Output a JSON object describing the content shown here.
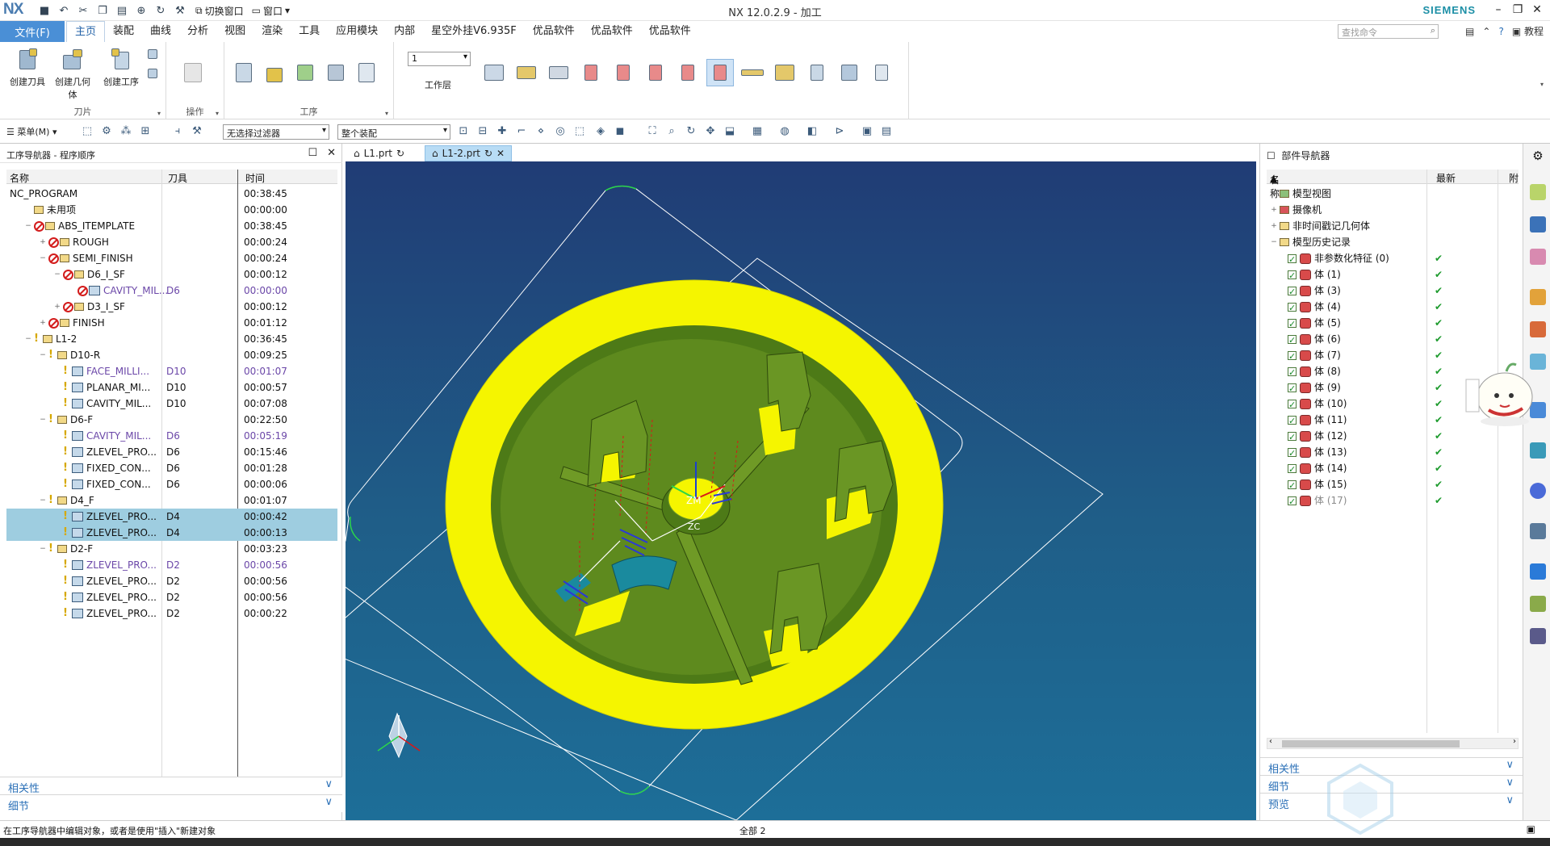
{
  "app": {
    "logo": "NX",
    "title": "NX 12.0.2.9 - 加工",
    "brand": "SIEMENS",
    "switch_window": "切换窗口",
    "window_menu": "窗口"
  },
  "menubar": {
    "file_label": "文件(F)",
    "tabs": [
      "主页",
      "装配",
      "曲线",
      "分析",
      "视图",
      "渲染",
      "工具",
      "应用模块",
      "内部",
      "星空外挂V6.935F",
      "优品软件",
      "优品软件",
      "优品软件"
    ],
    "active_tab": "主页",
    "search_placeholder": "查找命令",
    "help_label": "教程"
  },
  "ribbon": {
    "groups": [
      {
        "label": "刀片",
        "buttons": [
          "创建刀具",
          "创建几何体",
          "创建工序"
        ]
      },
      {
        "label": "操作"
      },
      {
        "label": "工序"
      }
    ],
    "work_layer_value": "1",
    "work_layer_label": "工作层"
  },
  "toolbar2": {
    "menu_label": "菜单(M)",
    "filter_combo": "无选择过滤器",
    "assembly_combo": "整个装配"
  },
  "op_navigator": {
    "title": "工序导航器 - 程序顺序",
    "columns": [
      "名称",
      "刀具",
      "时间"
    ],
    "rows": [
      {
        "indent": 0,
        "exp": "",
        "icon": "none",
        "name": "NC_PROGRAM",
        "tool": "",
        "time": "00:38:45",
        "muted": false,
        "sel": false
      },
      {
        "indent": 1,
        "exp": "",
        "icon": "fold",
        "name": "未用项",
        "tool": "",
        "time": "00:00:00",
        "muted": false,
        "sel": false
      },
      {
        "indent": 1,
        "exp": "−",
        "icon": "no-fold",
        "name": "ABS_ITEMPLATE",
        "tool": "",
        "time": "00:38:45",
        "muted": false,
        "sel": false
      },
      {
        "indent": 2,
        "exp": "+",
        "icon": "no-fold",
        "name": "ROUGH",
        "tool": "",
        "time": "00:00:24",
        "muted": false,
        "sel": false
      },
      {
        "indent": 2,
        "exp": "−",
        "icon": "no-fold",
        "name": "SEMI_FINISH",
        "tool": "",
        "time": "00:00:24",
        "muted": false,
        "sel": false
      },
      {
        "indent": 3,
        "exp": "−",
        "icon": "no-fold",
        "name": "D6_I_SF",
        "tool": "",
        "time": "00:00:12",
        "muted": false,
        "sel": false
      },
      {
        "indent": 4,
        "exp": "",
        "icon": "no-op",
        "name": "CAVITY_MIL...",
        "tool": "D6",
        "time": "00:00:00",
        "muted": true,
        "sel": false
      },
      {
        "indent": 3,
        "exp": "+",
        "icon": "no-fold",
        "name": "D3_I_SF",
        "tool": "",
        "time": "00:00:12",
        "muted": false,
        "sel": false
      },
      {
        "indent": 2,
        "exp": "+",
        "icon": "no-fold",
        "name": "FINISH",
        "tool": "",
        "time": "00:01:12",
        "muted": false,
        "sel": false
      },
      {
        "indent": 1,
        "exp": "−",
        "icon": "ok-fold",
        "name": "L1-2",
        "tool": "",
        "time": "00:36:45",
        "muted": false,
        "sel": false
      },
      {
        "indent": 2,
        "exp": "−",
        "icon": "ok-fold",
        "name": "D10-R",
        "tool": "",
        "time": "00:09:25",
        "muted": false,
        "sel": false
      },
      {
        "indent": 3,
        "exp": "",
        "icon": "ok-op",
        "name": "FACE_MILLI...",
        "tool": "D10",
        "time": "00:01:07",
        "muted": true,
        "sel": false
      },
      {
        "indent": 3,
        "exp": "",
        "icon": "ok-op",
        "name": "PLANAR_MI...",
        "tool": "D10",
        "time": "00:00:57",
        "muted": false,
        "sel": false
      },
      {
        "indent": 3,
        "exp": "",
        "icon": "ok-op",
        "name": "CAVITY_MIL...",
        "tool": "D10",
        "time": "00:07:08",
        "muted": false,
        "sel": false
      },
      {
        "indent": 2,
        "exp": "−",
        "icon": "ok-fold",
        "name": "D6-F",
        "tool": "",
        "time": "00:22:50",
        "muted": false,
        "sel": false
      },
      {
        "indent": 3,
        "exp": "",
        "icon": "ok-op",
        "name": "CAVITY_MIL...",
        "tool": "D6",
        "time": "00:05:19",
        "muted": true,
        "sel": false
      },
      {
        "indent": 3,
        "exp": "",
        "icon": "ok-op",
        "name": "ZLEVEL_PRO...",
        "tool": "D6",
        "time": "00:15:46",
        "muted": false,
        "sel": false
      },
      {
        "indent": 3,
        "exp": "",
        "icon": "ok-op",
        "name": "FIXED_CON...",
        "tool": "D6",
        "time": "00:01:28",
        "muted": false,
        "sel": false
      },
      {
        "indent": 3,
        "exp": "",
        "icon": "ok-op",
        "name": "FIXED_CON...",
        "tool": "D6",
        "time": "00:00:06",
        "muted": false,
        "sel": false
      },
      {
        "indent": 2,
        "exp": "−",
        "icon": "ok-fold",
        "name": "D4_F",
        "tool": "",
        "time": "00:01:07",
        "muted": false,
        "sel": false
      },
      {
        "indent": 3,
        "exp": "",
        "icon": "ok-op",
        "name": "ZLEVEL_PRO...",
        "tool": "D4",
        "time": "00:00:42",
        "muted": false,
        "sel": true
      },
      {
        "indent": 3,
        "exp": "",
        "icon": "ok-op",
        "name": "ZLEVEL_PRO...",
        "tool": "D4",
        "time": "00:00:13",
        "muted": false,
        "sel": true
      },
      {
        "indent": 2,
        "exp": "−",
        "icon": "ok-fold",
        "name": "D2-F",
        "tool": "",
        "time": "00:03:23",
        "muted": false,
        "sel": false
      },
      {
        "indent": 3,
        "exp": "",
        "icon": "ok-op",
        "name": "ZLEVEL_PRO...",
        "tool": "D2",
        "time": "00:00:56",
        "muted": true,
        "sel": false
      },
      {
        "indent": 3,
        "exp": "",
        "icon": "ok-op",
        "name": "ZLEVEL_PRO...",
        "tool": "D2",
        "time": "00:00:56",
        "muted": false,
        "sel": false
      },
      {
        "indent": 3,
        "exp": "",
        "icon": "ok-op",
        "name": "ZLEVEL_PRO...",
        "tool": "D2",
        "time": "00:00:56",
        "muted": false,
        "sel": false
      },
      {
        "indent": 3,
        "exp": "",
        "icon": "ok-op",
        "name": "ZLEVEL_PRO...",
        "tool": "D2",
        "time": "00:00:22",
        "muted": false,
        "sel": false
      }
    ],
    "sections": [
      "相关性",
      "细节"
    ]
  },
  "doc_tabs": [
    {
      "label": "L1.prt",
      "active": false
    },
    {
      "label": "L1-2.prt",
      "active": true
    }
  ],
  "viewport": {
    "labels": [
      "ZM",
      "ZC"
    ]
  },
  "part_navigator": {
    "title": "部件导航器",
    "columns": [
      "名称",
      "最新",
      "附"
    ],
    "rows": [
      {
        "indent": 0,
        "exp": "+",
        "kind": "view",
        "name": "模型视图",
        "latest": ""
      },
      {
        "indent": 0,
        "exp": "+",
        "kind": "camera",
        "name": "摄像机",
        "latest": ""
      },
      {
        "indent": 0,
        "exp": "+",
        "kind": "folder",
        "name": "非时间戳记几何体",
        "latest": ""
      },
      {
        "indent": 0,
        "exp": "−",
        "kind": "folder",
        "name": "模型历史记录",
        "latest": ""
      },
      {
        "indent": 1,
        "exp": "",
        "kind": "body",
        "name": "非参数化特征 (0)",
        "latest": "✔"
      },
      {
        "indent": 1,
        "exp": "",
        "kind": "body",
        "name": "体 (1)",
        "latest": "✔"
      },
      {
        "indent": 1,
        "exp": "",
        "kind": "body",
        "name": "体 (3)",
        "latest": "✔"
      },
      {
        "indent": 1,
        "exp": "",
        "kind": "body",
        "name": "体 (4)",
        "latest": "✔"
      },
      {
        "indent": 1,
        "exp": "",
        "kind": "body",
        "name": "体 (5)",
        "latest": "✔"
      },
      {
        "indent": 1,
        "exp": "",
        "kind": "body",
        "name": "体 (6)",
        "latest": "✔"
      },
      {
        "indent": 1,
        "exp": "",
        "kind": "body",
        "name": "体 (7)",
        "latest": "✔"
      },
      {
        "indent": 1,
        "exp": "",
        "kind": "body",
        "name": "体 (8)",
        "latest": "✔"
      },
      {
        "indent": 1,
        "exp": "",
        "kind": "body",
        "name": "体 (9)",
        "latest": "✔"
      },
      {
        "indent": 1,
        "exp": "",
        "kind": "body",
        "name": "体 (10)",
        "latest": "✔"
      },
      {
        "indent": 1,
        "exp": "",
        "kind": "body",
        "name": "体 (11)",
        "latest": "✔"
      },
      {
        "indent": 1,
        "exp": "",
        "kind": "body",
        "name": "体 (12)",
        "latest": "✔"
      },
      {
        "indent": 1,
        "exp": "",
        "kind": "body",
        "name": "体 (13)",
        "latest": "✔"
      },
      {
        "indent": 1,
        "exp": "",
        "kind": "body",
        "name": "体 (14)",
        "latest": "✔"
      },
      {
        "indent": 1,
        "exp": "",
        "kind": "body",
        "name": "体 (15)",
        "latest": "✔"
      },
      {
        "indent": 1,
        "exp": "",
        "kind": "body",
        "name": "体 (17)",
        "latest": "✔",
        "muted": true
      }
    ],
    "sections": [
      "相关性",
      "细节",
      "预览"
    ]
  },
  "status": {
    "message": "在工序导航器中编辑对象，或者是使用\"插入\"新建对象",
    "center": "全部 2"
  },
  "colors": {
    "accent": "#4a8fd6",
    "selection": "#9ecde0",
    "muted_text": "#6b47a8",
    "viewport_top": "#203c75",
    "viewport_bottom": "#1d6e98",
    "part_yellow": "#f5f500",
    "part_green": "#5e8a1e"
  }
}
